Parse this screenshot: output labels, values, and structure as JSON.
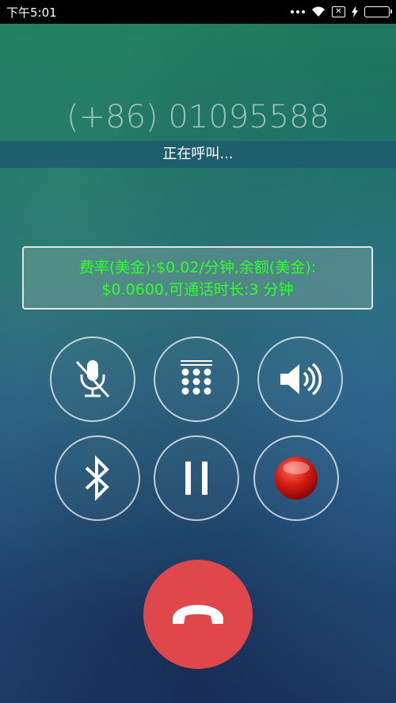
{
  "status_bar": {
    "time": "下午5:01",
    "icons": [
      "more-dots-icon",
      "wifi-icon",
      "sim-off-icon",
      "charging-bolt-icon",
      "battery-icon"
    ],
    "battery_color": "#6cd23c"
  },
  "call": {
    "number": "(+86) 01095588",
    "status": "正在呼叫...",
    "rate_line1": "费率(美金):$0.02/分钟,余额(美金):",
    "rate_line2": "$0.0600,可通话时长:3 分钟"
  },
  "controls": [
    {
      "name": "mute",
      "icon": "mic-muted-icon"
    },
    {
      "name": "dialpad",
      "icon": "dialpad-icon"
    },
    {
      "name": "speaker",
      "icon": "speaker-icon"
    },
    {
      "name": "bluetooth",
      "icon": "bluetooth-icon"
    },
    {
      "name": "hold",
      "icon": "pause-icon"
    },
    {
      "name": "record",
      "icon": "record-icon"
    }
  ],
  "hangup": {
    "icon": "hang-up-icon",
    "color": "#e0474a"
  },
  "colors": {
    "rate_text": "#2dff2a"
  }
}
